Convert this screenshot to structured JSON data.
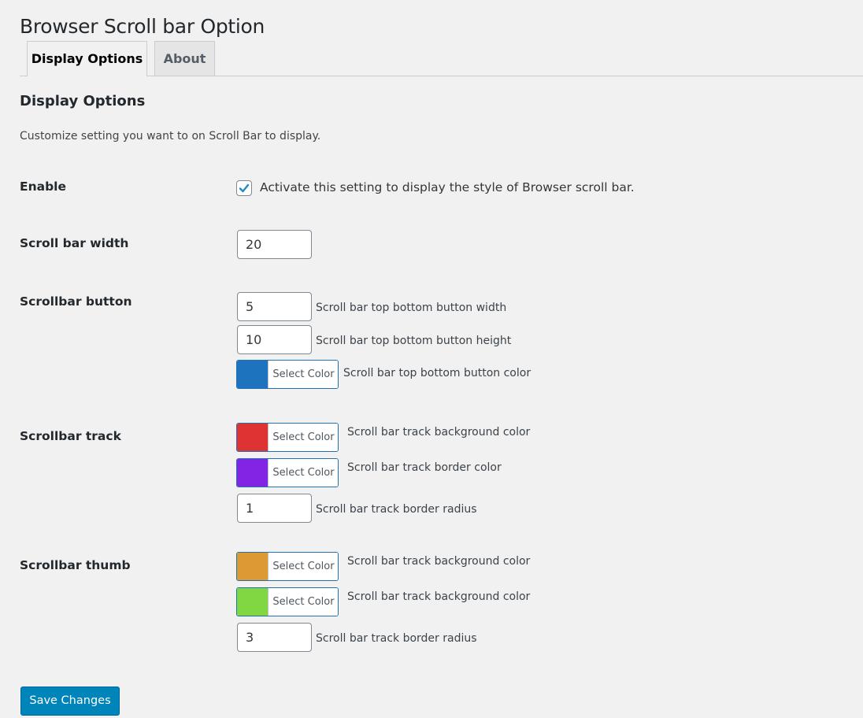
{
  "page": {
    "title": "Browser Scroll bar Option"
  },
  "tabs": [
    {
      "label": "Display Options",
      "active": true
    },
    {
      "label": "About",
      "active": false
    }
  ],
  "section": {
    "title": "Display Options",
    "description": "Customize setting you want to on Scroll Bar to display."
  },
  "enable": {
    "label": "Enable",
    "checked": true,
    "checkbox_label": "Activate this setting to display the style of Browser scroll bar."
  },
  "width": {
    "label": "Scroll bar width",
    "value": "20"
  },
  "button": {
    "label": "Scrollbar button",
    "width_value": "5",
    "width_desc": "Scroll bar top bottom button width",
    "height_value": "10",
    "height_desc": "Scroll bar top bottom button height",
    "color": "#1e73be",
    "color_label": "Select Color",
    "color_desc": "Scroll bar top bottom button color"
  },
  "track": {
    "label": "Scrollbar track",
    "bg_color": "#dd3333",
    "bg_color_label": "Select Color",
    "bg_desc": "Scroll bar track background color",
    "border_color": "#8224e3",
    "border_color_label": "Select Color",
    "border_desc": "Scroll bar track border color",
    "radius_value": "1",
    "radius_desc": "Scroll bar track border radius"
  },
  "thumb": {
    "label": "Scrollbar thumb",
    "bg_color": "#dd9933",
    "bg_color_label": "Select Color",
    "bg_desc": "Scroll bar track background color",
    "bg2_color": "#81d742",
    "bg2_color_label": "Select Color",
    "bg2_desc": "Scroll bar track background color",
    "radius_value": "3",
    "radius_desc": "Scroll bar track border radius"
  },
  "save": {
    "label": "Save Changes"
  },
  "colors": {
    "primary": "#0085ba",
    "checkmark": "#1e8cbe",
    "background": "#f1f1f1"
  }
}
